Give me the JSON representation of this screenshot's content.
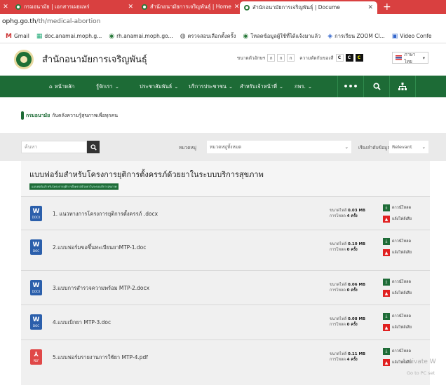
{
  "browser": {
    "tabs": [
      {
        "label": "กรมอนามัย | เอกสารเผยแพร่"
      },
      {
        "label": "สำนักอนามัยการเจริญพันธุ์ | Home"
      },
      {
        "label": "สำนักอนามัยการเจริญพันธุ์ | Docume"
      }
    ],
    "address_host": "ophg.go.th",
    "address_path": "/th/medical-abortion",
    "bookmarks": [
      {
        "icon": "M",
        "label": "Gmail"
      },
      {
        "icon": "▦",
        "label": "doc.anamai.moph.g..."
      },
      {
        "icon": "◉",
        "label": "rh.anamai.moph.go..."
      },
      {
        "icon": "◍",
        "label": "ตรวจสอบเลือกตั้งครั้ง"
      },
      {
        "icon": "◉",
        "label": "โหลดข้อมูลผู้ใช้ที่ได้แจ้งมาแล้ว"
      },
      {
        "icon": "◈",
        "label": "การเรียน ZOOM Cl..."
      },
      {
        "icon": "▣",
        "label": "Video Confe"
      }
    ]
  },
  "site": {
    "title": "สำนักอนามัยการเจริญพันธุ์",
    "font_label": "ขนาดตัวอักษร",
    "font_sizes": [
      "ก",
      "ก",
      "ก"
    ],
    "contrast_label": "ความตัดกันของสี",
    "contrast_options": [
      "C",
      "C",
      "C"
    ],
    "language": "ภาษาไทย"
  },
  "nav": {
    "items": [
      "หน้าหลัก",
      "รู้จักเรา",
      "ประชาสัมพันธ์",
      "บริการประชาชน",
      "สำหรับเจ้าหน้าที่",
      "กพร."
    ],
    "more": "•••"
  },
  "tagline": {
    "brand": "กรมอนามัย",
    "text": "กับคลังความรู้สุขภาพเพื่อทุกคน"
  },
  "search": {
    "placeholder": "ค้นหา",
    "category_label": "หมวดหมู่",
    "category_value": "หมวดหมู่ทั้งหมด",
    "sort_label": "เรียงลำดับข้อมูล",
    "sort_value": "Relevant"
  },
  "docs": {
    "section_title": "แบบฟอร์มสำหรับโครงการยุติการตั้งครรภ์ด้วยยาในระบบบริการสุขภาพ",
    "section_tag": "แบบฟอร์มสำหรับโครงการยุติการตั้งครรภ์ด้วยยาในระบบบริการสุขภาพ",
    "size_label": "ขนาดไฟล์",
    "downloads_label": "การโหลด",
    "download_action": "ดาวน์โหลด",
    "report_action": "แจ้งไฟล์เสีย",
    "files": [
      {
        "name": "1. แนวทางการโครงการยุติการตั้งครรภ์ .docx",
        "type": "word",
        "ext": "DOCX",
        "size": "0.03 MB",
        "downloads": "4 ครั้ง"
      },
      {
        "name": "2.แบบฟอร์มขอขึ้นทะเบียนยาMTP-1.doc",
        "type": "word",
        "ext": "DOC",
        "size": "0.10 MB",
        "downloads": "0 ครั้ง"
      },
      {
        "name": "3.แบบการสำรวจความพร้อม MTP-2.docx",
        "type": "word",
        "ext": "DOCX",
        "size": "0.06 MB",
        "downloads": "0 ครั้ง"
      },
      {
        "name": "4.แบบเบิกยา MTP-3.doc",
        "type": "word",
        "ext": "DOC",
        "size": "0.08 MB",
        "downloads": "0 ครั้ง"
      },
      {
        "name": "5.แบบฟอร์มรายงานการใช้ยา MTP-4.pdf",
        "type": "pdf",
        "ext": "PDF",
        "size": "0.11 MB",
        "downloads": "4 ครั้ง"
      }
    ]
  },
  "watermark": {
    "line1": "Activate W",
    "line2": "Go to PC set"
  },
  "colors": {
    "tab_bar": "#d94040",
    "nav_green": "#1d6b36",
    "word_blue": "#2b5fab",
    "pdf_red": "#e04848"
  }
}
